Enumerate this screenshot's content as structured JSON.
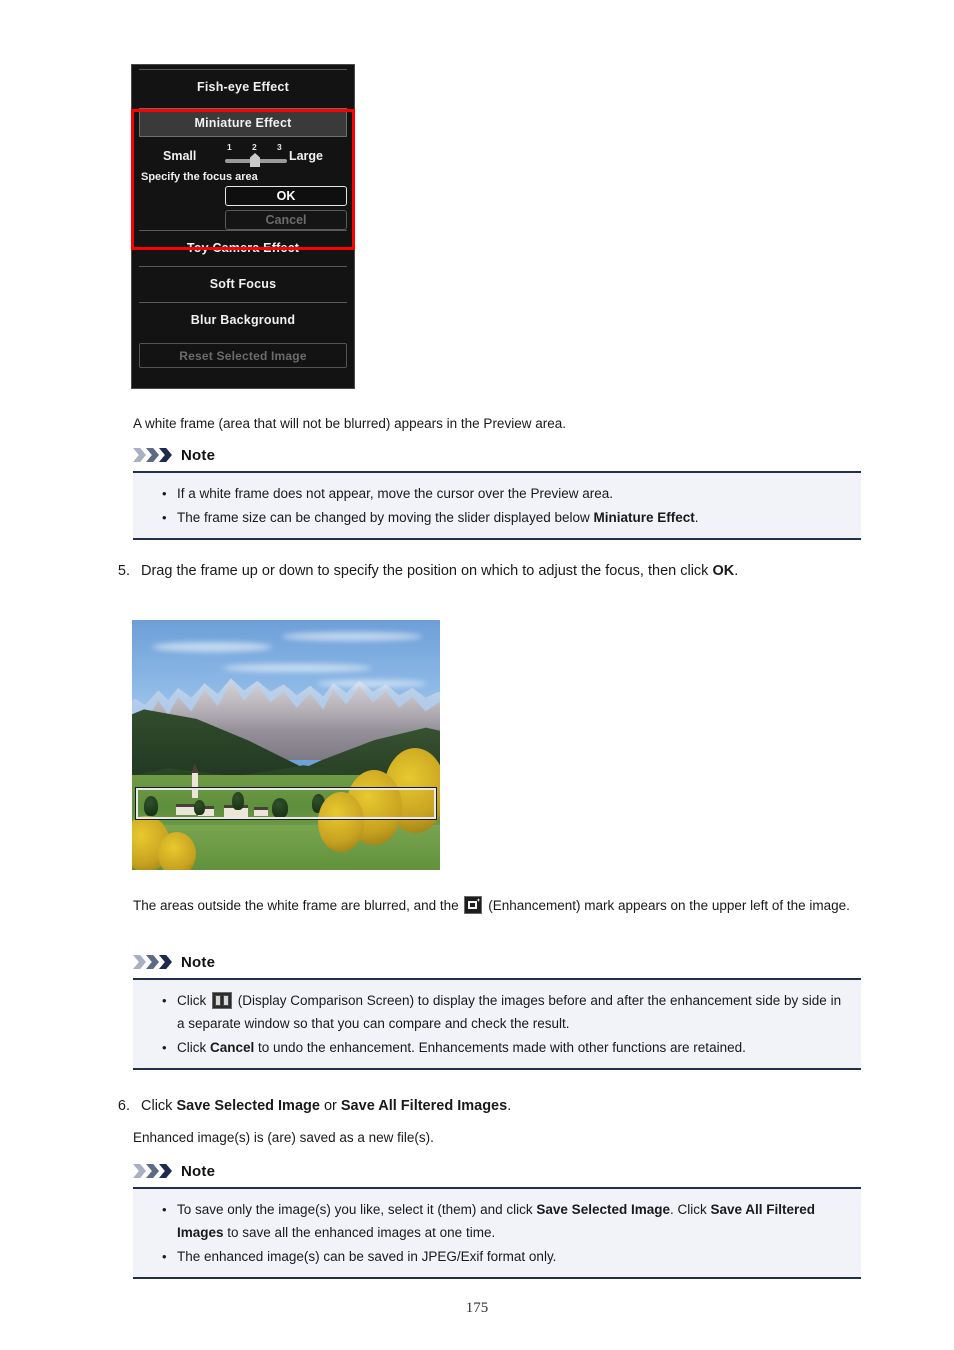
{
  "effect_panel": {
    "fisheye_label": "Fish-eye Effect",
    "miniature_label": "Miniature Effect",
    "slider": {
      "min_label": "Small",
      "max_label": "Large",
      "ticks": [
        "1",
        "2",
        "3"
      ],
      "value": 2
    },
    "focus_hint": "Specify the focus area",
    "ok_label": "OK",
    "cancel_label": "Cancel",
    "toy_camera_label": "Toy Camera Effect",
    "soft_focus_label": "Soft Focus",
    "blur_background_label": "Blur Background",
    "reset_label": "Reset Selected Image",
    "highlight_color": "#ff0000"
  },
  "intro_text": "A white frame (area that will not be blurred) appears in the Preview area.",
  "note1": {
    "title": "Note",
    "items_html": [
      "If a white frame does not appear, move the cursor over the Preview area.",
      "The frame size can be changed by moving the slider displayed below <b>Miniature Effect</b>."
    ]
  },
  "step5": {
    "number": "5.",
    "text_html": "Drag the frame up or down to specify the position on which to adjust the focus, then click <b>OK</b>."
  },
  "image_caption_html": "The areas outside the white frame are blurred, and the <span class=\"icon-enh\" data-name=\"enhancement-icon\" data-interactable=\"false\"></span> (Enhancement) mark appears on the upper left of the image.",
  "note2": {
    "title": "Note",
    "items_html": [
      "Click <span class=\"icon-cmp\" data-name=\"display-comparison-screen-icon\" data-interactable=\"false\"></span> (Display Comparison Screen) to display the images before and after the enhancement side by side in a separate window so that you can compare and check the result.",
      "Click <b>Cancel</b> to undo the enhancement. Enhancements made with other functions are retained."
    ]
  },
  "step6": {
    "number": "6.",
    "text_html": "Click <b>Save Selected Image</b> or <b>Save All Filtered Images</b>.",
    "sub_text": "Enhanced image(s) is (are) saved as a new file(s)."
  },
  "note3": {
    "title": "Note",
    "items_html": [
      "To save only the image(s) you like, select it (them) and click <b>Save Selected Image</b>. Click <b>Save All Filtered Images</b> to save all the enhanced images at one time.",
      "The enhanced image(s) can be saved in JPEG/Exif format only."
    ]
  },
  "page_number": "175"
}
